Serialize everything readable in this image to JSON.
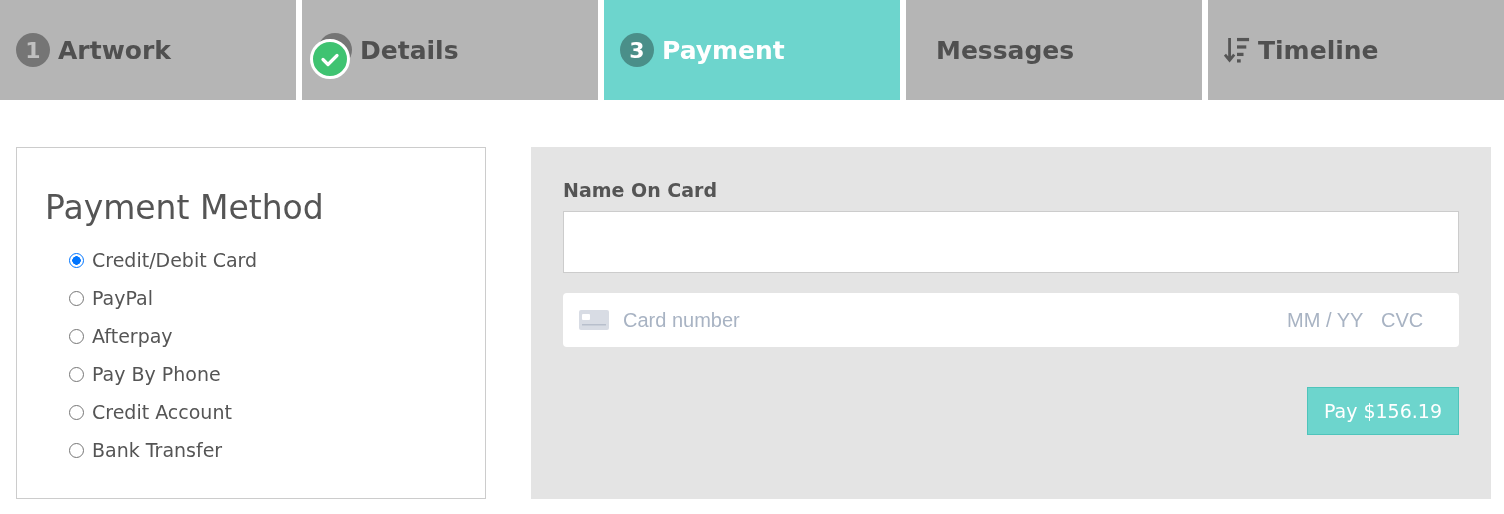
{
  "tabs": [
    {
      "kind": "number",
      "number": "1",
      "label": "Artwork",
      "selected": false,
      "completed": false
    },
    {
      "kind": "number",
      "label": "Details",
      "selected": false,
      "completed": true
    },
    {
      "kind": "number",
      "number": "3",
      "label": "Payment",
      "selected": true,
      "completed": false
    },
    {
      "kind": "plain",
      "label": "Messages",
      "selected": false,
      "completed": false
    },
    {
      "kind": "sort",
      "label": "Timeline",
      "selected": false,
      "completed": false
    }
  ],
  "payment_method": {
    "title": "Payment Method",
    "options": [
      {
        "label": "Credit/Debit Card",
        "selected": true
      },
      {
        "label": "PayPal",
        "selected": false
      },
      {
        "label": "Afterpay",
        "selected": false
      },
      {
        "label": "Pay By Phone",
        "selected": false
      },
      {
        "label": "Credit Account",
        "selected": false
      },
      {
        "label": "Bank Transfer",
        "selected": false
      }
    ]
  },
  "card_form": {
    "name_label": "Name On Card",
    "card_number": {
      "placeholder": "Card number"
    },
    "expiry": {
      "placeholder": "MM / YY"
    },
    "cvc": {
      "placeholder": "CVC"
    },
    "pay_button": "Pay $156.19"
  }
}
